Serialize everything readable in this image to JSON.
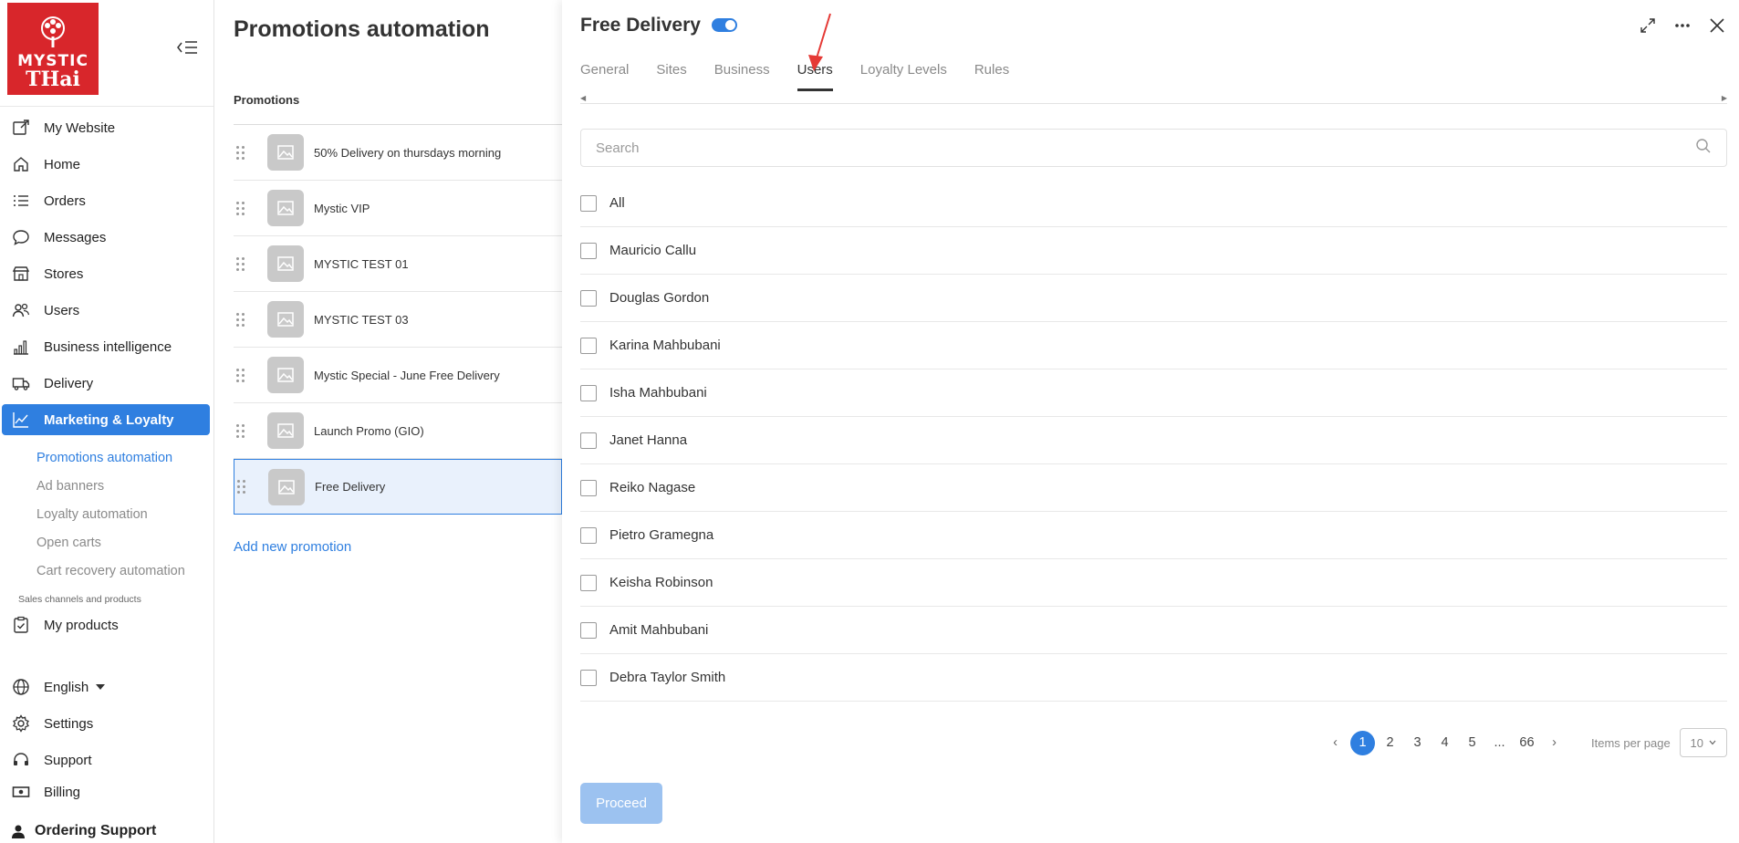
{
  "brand": {
    "logo_line1": "MYSTIC",
    "logo_line2": "THai",
    "logo_color": "#d8262b"
  },
  "sidebar": {
    "items": [
      {
        "label": "My Website",
        "icon": "external-link-icon"
      },
      {
        "label": "Home",
        "icon": "home-icon"
      },
      {
        "label": "Orders",
        "icon": "list-icon"
      },
      {
        "label": "Messages",
        "icon": "chat-bubble-icon"
      },
      {
        "label": "Stores",
        "icon": "store-icon"
      },
      {
        "label": "Users",
        "icon": "users-icon"
      },
      {
        "label": "Business intelligence",
        "icon": "bar-chart-icon"
      },
      {
        "label": "Delivery",
        "icon": "truck-icon"
      },
      {
        "label": "Marketing & Loyalty",
        "icon": "trend-line-icon",
        "active": true
      }
    ],
    "sub_items": [
      {
        "label": "Promotions automation",
        "active": true
      },
      {
        "label": "Ad banners"
      },
      {
        "label": "Loyalty automation"
      },
      {
        "label": "Open carts"
      },
      {
        "label": "Cart recovery automation"
      }
    ],
    "section_label": "Sales channels and products",
    "products_label": "My products",
    "bottom": [
      {
        "label": "English",
        "icon": "globe-icon"
      },
      {
        "label": "Settings",
        "icon": "gear-icon"
      },
      {
        "label": "Support",
        "icon": "headset-icon"
      },
      {
        "label": "Billing",
        "icon": "cash-icon"
      }
    ],
    "user_label": "Ordering Support",
    "accent": "#2f7fe0"
  },
  "main": {
    "title": "Promotions automation",
    "list_header": "Promotions",
    "promotions": [
      "50% Delivery on thursdays morning",
      "Mystic VIP",
      "MYSTIC TEST 01",
      "MYSTIC TEST 03",
      "Mystic Special - June Free Delivery",
      "Launch Promo (GIO)",
      "Free Delivery"
    ],
    "selected_index": 6,
    "add_label": "Add new promotion"
  },
  "panel": {
    "title": "Free Delivery",
    "enabled": true,
    "tabs": [
      "General",
      "Sites",
      "Business",
      "Users",
      "Loyalty Levels",
      "Rules"
    ],
    "active_tab": "Users",
    "search_placeholder": "Search",
    "all_label": "All",
    "users": [
      "Mauricio Callu",
      "Douglas Gordon",
      "Karina Mahbubani",
      "Isha Mahbubani",
      "Janet Hanna",
      "Reiko Nagase",
      "Pietro Gramegna",
      "Keisha Robinson",
      "Amit Mahbubani",
      "Debra Taylor Smith"
    ],
    "pagination": {
      "pages": [
        "1",
        "2",
        "3",
        "4",
        "5",
        "...",
        "66"
      ],
      "current": "1"
    },
    "items_per_page_label": "Items per page",
    "items_per_page": "10",
    "proceed_label": "Proceed"
  }
}
